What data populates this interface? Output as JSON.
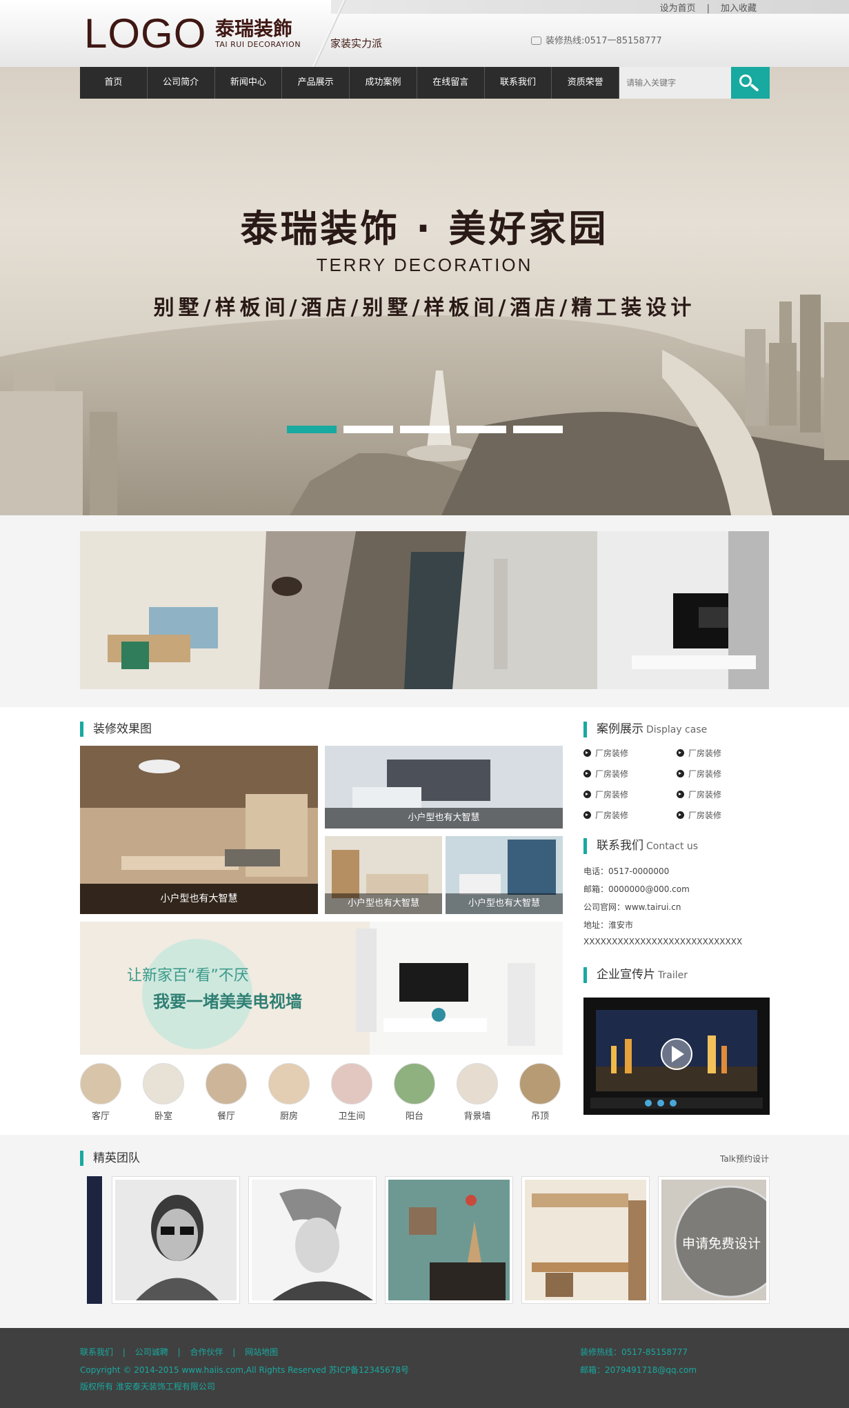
{
  "header": {
    "logo_text": "LOGO",
    "logo_cn": "泰瑞装飾",
    "logo_en": "TAI RUI DECORAYION",
    "slogan": "家装实力派",
    "links": [
      "设为首页",
      "加入收藏"
    ],
    "separator": "|",
    "hotline": "装修热线:0517一85158777"
  },
  "nav": {
    "items": [
      "首页",
      "公司简介",
      "新闻中心",
      "产品展示",
      "成功案例",
      "在线留言",
      "联系我们",
      "资质荣誉"
    ],
    "search_placeholder": "请输入关键字"
  },
  "banner": {
    "title": "泰瑞装饰 · 美好家园",
    "subtitle_en": "TERRY DECORATION",
    "tagline": "别墅/样板间/酒店/别墅/样板间/酒店/精工装设计",
    "slides": 5,
    "active_slide": 1
  },
  "effects": {
    "title": "装修效果图",
    "captions": [
      "小户型也有大智慧",
      "小户型也有大智慧",
      "小户型也有大智慧",
      "小户型也有大智慧"
    ],
    "promo_line1": "让新家百“看”不厌",
    "promo_line2": "我要一堵美美电视墙",
    "rooms": [
      "客厅",
      "卧室",
      "餐厅",
      "厨房",
      "卫生间",
      "阳台",
      "背景墙",
      "吊顶"
    ]
  },
  "cases": {
    "title": "案例展示",
    "title_en": "Display case",
    "items": [
      "厂房装修",
      "厂房装修",
      "厂房装修",
      "厂房装修",
      "厂房装修",
      "厂房装修",
      "厂房装修",
      "厂房装修"
    ]
  },
  "contact": {
    "title": "联系我们",
    "title_en": "Contact us",
    "lines": [
      "电话：0517-0000000",
      "邮箱：0000000@000.com",
      "公司官网：www.tairui.cn",
      "地址：淮安市",
      "XXXXXXXXXXXXXXXXXXXXXXXXXXXX"
    ]
  },
  "trailer": {
    "title": "企业宣传片",
    "title_en": "Trailer"
  },
  "team": {
    "title": "精英团队",
    "talk_link": "Talk预约设计",
    "apply_label": "申请免费设计"
  },
  "footer": {
    "links": [
      "联系我们",
      "公司诚聘",
      "合作伙伴",
      "网站地图"
    ],
    "separator": "|",
    "copyright": "Copyright © 2014-2015 www.haiis.com,All Rights Reserved 苏ICP备12345678号",
    "owner": "版权所有 淮安泰天装饰工程有限公司",
    "hotline": "装修热线：0517-85158777",
    "email": "邮箱：2079491718@qq.com"
  },
  "colors": {
    "accent": "#18a9a0",
    "nav_bg": "#2c2c2c",
    "footer_bg": "#404040",
    "brand": "#3f1713"
  }
}
